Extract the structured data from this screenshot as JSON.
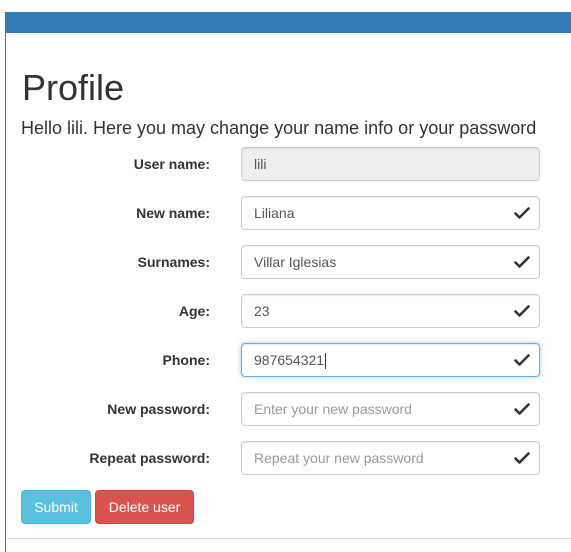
{
  "profile": {
    "title": "Profile",
    "greeting": "Hello lili. Here you may change your name info or your password"
  },
  "form": {
    "username": {
      "label": "User name:",
      "value": "lili"
    },
    "new_name": {
      "label": "New name:",
      "value": "Liliana"
    },
    "surnames": {
      "label": "Surnames:",
      "value": "Villar Iglesias"
    },
    "age": {
      "label": "Age:",
      "value": "23"
    },
    "phone": {
      "label": "Phone:",
      "value": "987654321"
    },
    "new_password": {
      "label": "New password:",
      "placeholder": "Enter your new password"
    },
    "repeat_password": {
      "label": "Repeat password:",
      "placeholder": "Repeat your new password"
    }
  },
  "buttons": {
    "submit": "Submit",
    "delete": "Delete user"
  },
  "colors": {
    "primary": "#337ab7",
    "info": "#5bc0de",
    "danger": "#d9534f",
    "focus": "#66afe9"
  },
  "icons": {
    "valid": "checkmark-icon"
  }
}
